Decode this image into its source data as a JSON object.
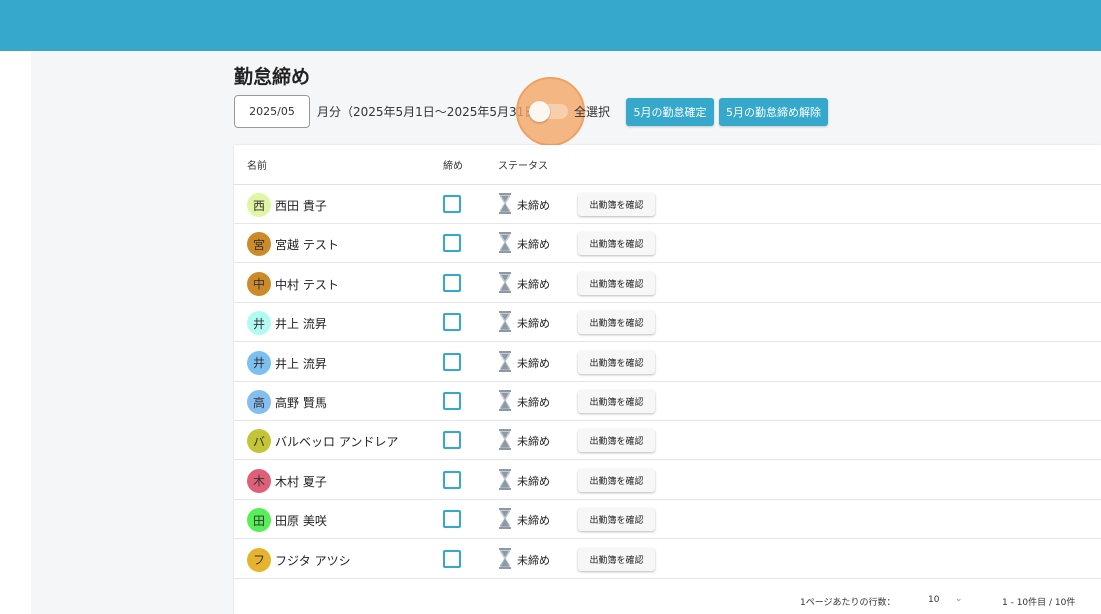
{
  "page": {
    "title": "勤怠締め",
    "month_value": "2025/05",
    "month_suffix": "月分（2025年5月1日〜2025年5月31日）",
    "select_all_label": "全選択",
    "confirm_button": "5月の勤怠確定",
    "release_button": "5月の勤怠締め解除"
  },
  "table": {
    "headers": {
      "name": "名前",
      "close": "締め",
      "status": "ステータス"
    },
    "rows": [
      {
        "initial": "西",
        "avatar_color": "#dff7a5",
        "name": "西田 貴子",
        "status": "未締め",
        "action": "出勤簿を確認"
      },
      {
        "initial": "宮",
        "avatar_color": "#cc8a2a",
        "name": "宮越 テスト",
        "status": "未締め",
        "action": "出勤簿を確認"
      },
      {
        "initial": "中",
        "avatar_color": "#cc8a2a",
        "name": "中村 テスト",
        "status": "未締め",
        "action": "出勤簿を確認"
      },
      {
        "initial": "井",
        "avatar_color": "#b2fbf3",
        "name": "井上 流昇",
        "status": "未締め",
        "action": "出勤簿を確認"
      },
      {
        "initial": "井",
        "avatar_color": "#7cc0f2",
        "name": "井上 流昇",
        "status": "未締め",
        "action": "出勤簿を確認"
      },
      {
        "initial": "高",
        "avatar_color": "#85bdef",
        "name": "高野 賢馬",
        "status": "未締め",
        "action": "出勤簿を確認"
      },
      {
        "initial": "バ",
        "avatar_color": "#c2c535",
        "name": "バルベッロ アンドレア",
        "status": "未締め",
        "action": "出勤簿を確認"
      },
      {
        "initial": "木",
        "avatar_color": "#e05f78",
        "name": "木村 夏子",
        "status": "未締め",
        "action": "出勤簿を確認"
      },
      {
        "initial": "田",
        "avatar_color": "#58ee58",
        "name": "田原 美咲",
        "status": "未締め",
        "action": "出勤簿を確認"
      },
      {
        "initial": "フ",
        "avatar_color": "#e6b42c",
        "name": "フジタ アツシ",
        "status": "未締め",
        "action": "出勤簿を確認"
      }
    ]
  },
  "footer": {
    "rows_per_page_label": "1ページあたりの行数：",
    "rows_per_page": "10",
    "range": "1 - 10件目 / 10件"
  },
  "colors": {
    "accent": "#35a8cc",
    "toggle_focus": "#f3a460",
    "hourglass": "#8e99a6"
  },
  "icons": {
    "status": "hourglass-icon",
    "rows_select": "chevron-down-icon"
  }
}
